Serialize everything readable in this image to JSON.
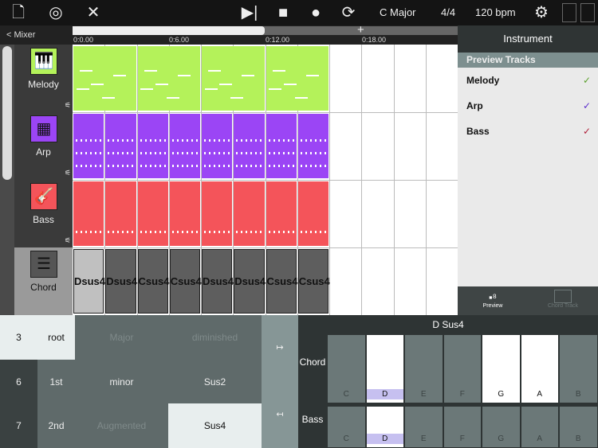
{
  "toolbar": {
    "icons": [
      "new-file-icon",
      "disc-icon",
      "tools-icon",
      "play-to-end-icon",
      "stop-icon",
      "record-icon",
      "loop-play-icon",
      "gear-icon",
      "layout-icon"
    ],
    "key": "C Major",
    "time_signature": "4/4",
    "tempo": "120 bpm"
  },
  "timeline": {
    "back_label": "< Mixer",
    "add_label": "+",
    "markers": [
      "0:0.00",
      "0:6.00",
      "0:12.00",
      "0:18.00"
    ]
  },
  "tracks": [
    {
      "name": "Melody",
      "icon": "piano-icon",
      "color": "#b4f25a"
    },
    {
      "name": "Arp",
      "icon": "xylophone-icon",
      "color": "#9b45f5"
    },
    {
      "name": "Bass",
      "icon": "guitar-icon",
      "color": "#f4545a"
    },
    {
      "name": "Chord",
      "icon": "mixer-icon",
      "color": "#5e5e5e"
    }
  ],
  "chord_clips": [
    "Dsus4",
    "Dsus4",
    "Csus4",
    "Csus4",
    "Dsus4",
    "Dsus4",
    "Csus4",
    "Csus4"
  ],
  "right_panel": {
    "title": "Instrument",
    "section": "Preview Tracks",
    "items": [
      {
        "name": "Melody",
        "check_color": "#5aa02c"
      },
      {
        "name": "Arp",
        "check_color": "#5a2ccc"
      },
      {
        "name": "Bass",
        "check_color": "#b0203a"
      }
    ],
    "tabs": [
      {
        "label": "Preview",
        "active": true
      },
      {
        "label": "Chord Track",
        "active": false
      }
    ]
  },
  "chord_picker": {
    "octaves": [
      "3",
      "6",
      "7"
    ],
    "inversions": [
      "root",
      "1st",
      "2nd"
    ],
    "qualities": [
      [
        "Major",
        "diminished"
      ],
      [
        "minor",
        "Sus2"
      ],
      [
        "Augmented",
        "Sus4"
      ]
    ],
    "selected_octave": "3",
    "selected_inversion": "root",
    "selected_quality": "Sus4",
    "arrows": [
      "↦",
      "↤"
    ]
  },
  "keyboard": {
    "title": "D Sus4",
    "rows": [
      "Chord",
      "Bass"
    ],
    "notes": [
      "C",
      "D",
      "E",
      "F",
      "G",
      "A",
      "B"
    ],
    "chord_notes": [
      "D",
      "G",
      "A"
    ],
    "bass_notes": [
      "D"
    ],
    "root": "D"
  }
}
